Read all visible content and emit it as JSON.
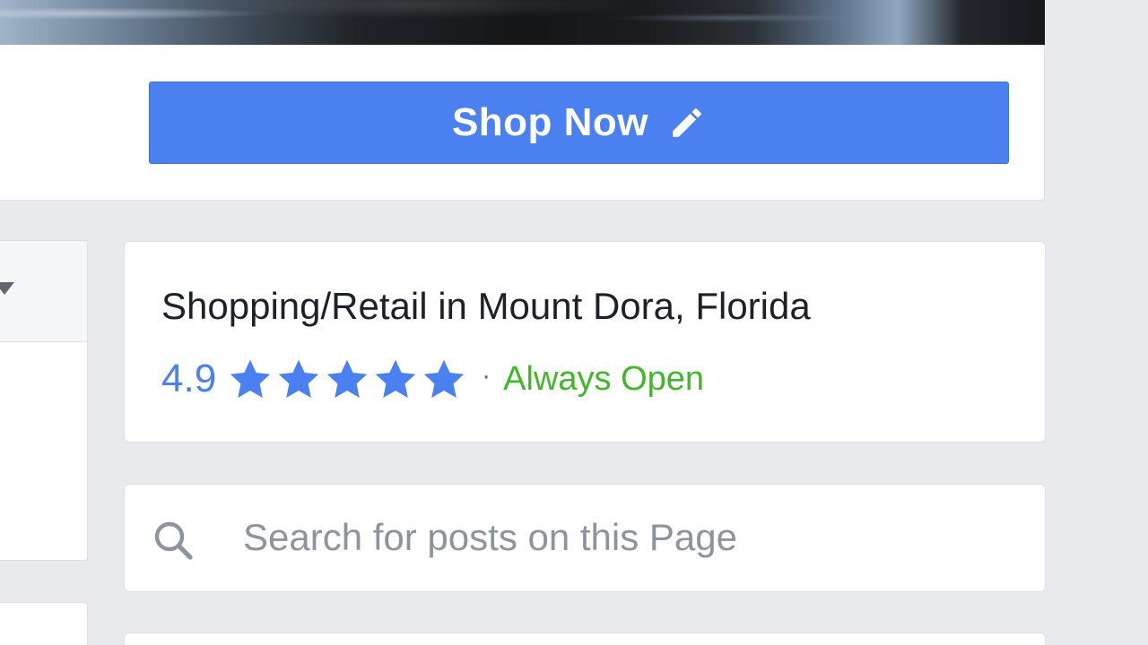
{
  "cta": {
    "label": "Shop Now",
    "icon": "pencil-icon",
    "color": "#4b80f0"
  },
  "page_info": {
    "category": "Shopping/Retail in Mount Dora, Florida",
    "rating": "4.9",
    "stars": 5,
    "rating_color": "#4b80f0",
    "separator": "·",
    "hours_status": "Always Open",
    "hours_color": "#42b72a"
  },
  "search": {
    "placeholder": "Search for posts on this Page",
    "value": "",
    "icon": "search-icon"
  }
}
